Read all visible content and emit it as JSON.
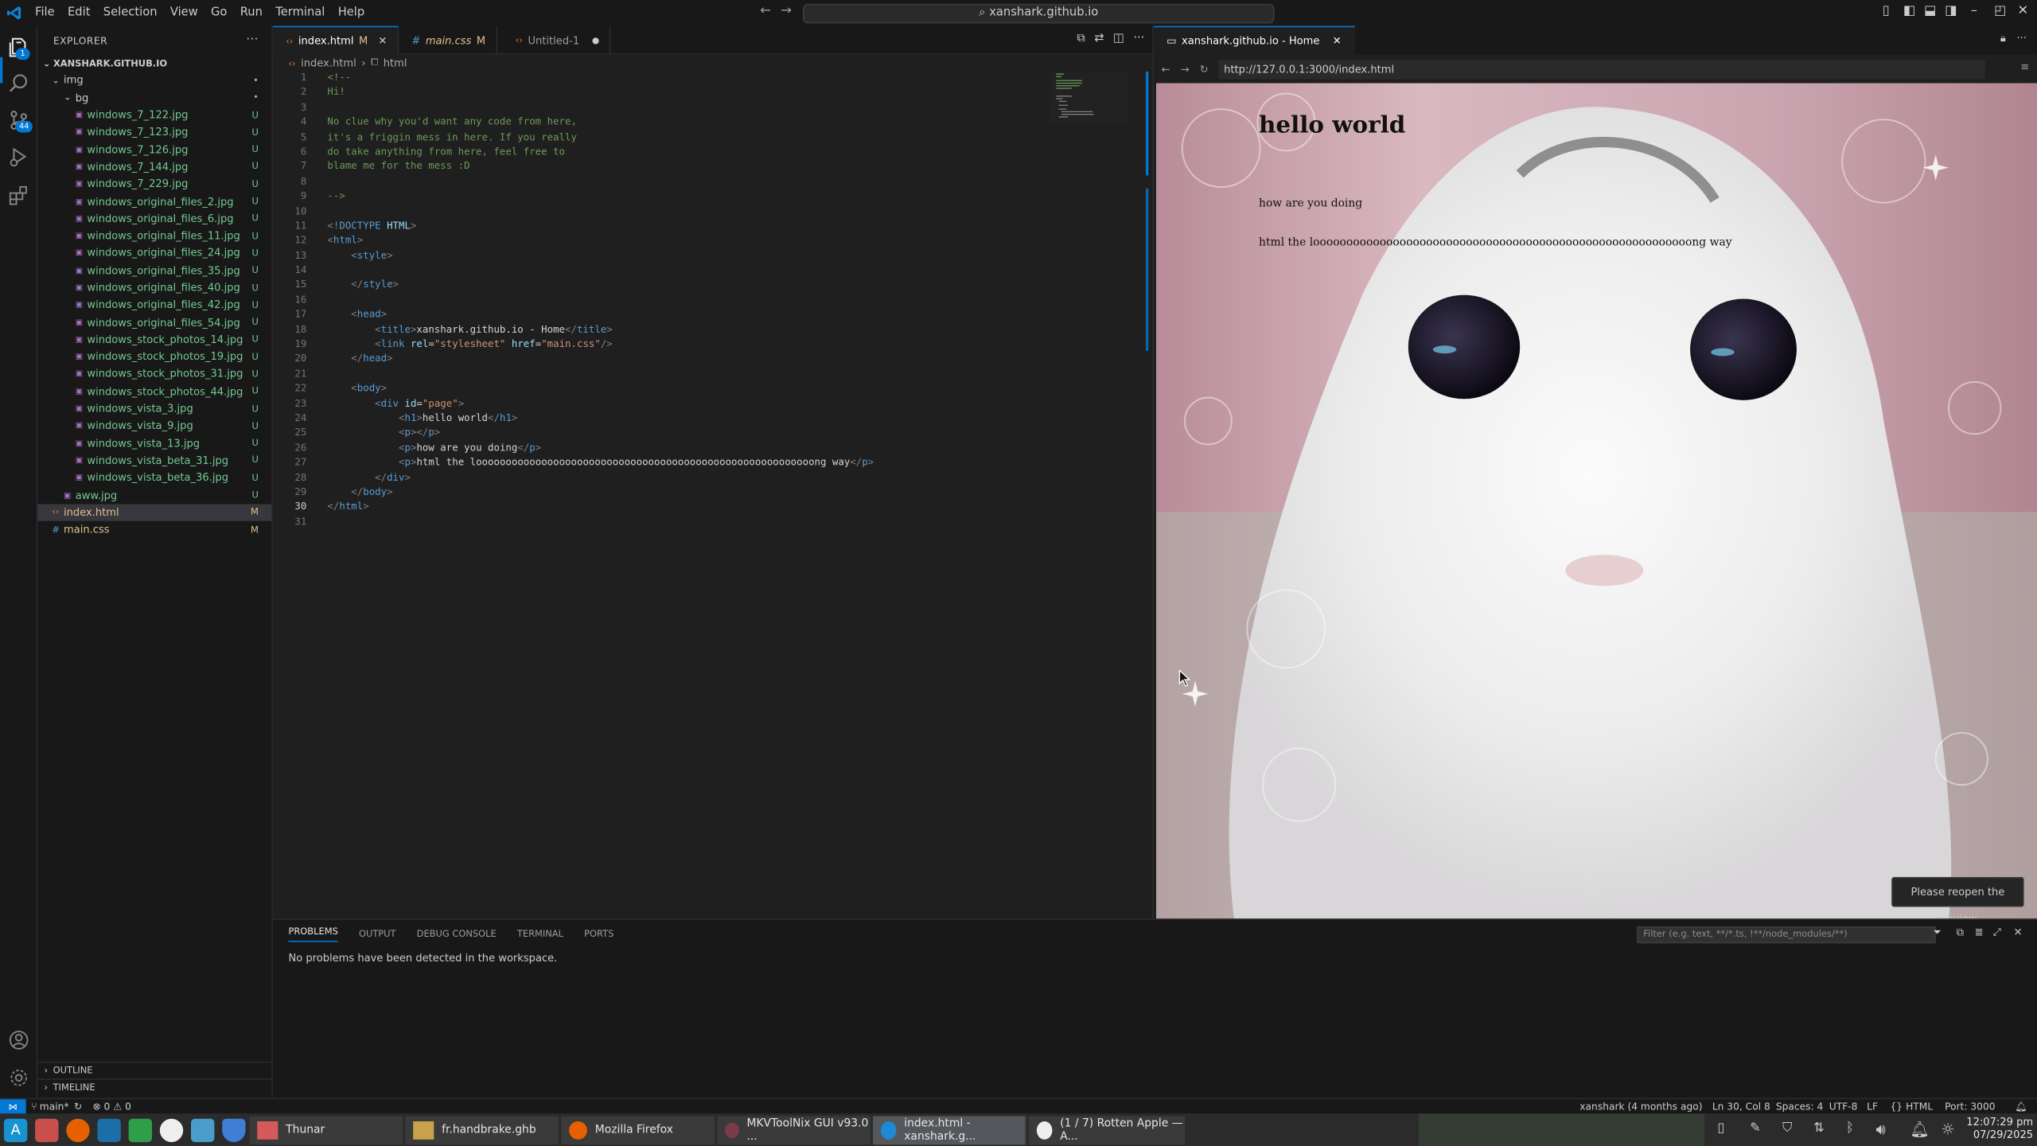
{
  "menu": [
    "File",
    "Edit",
    "Selection",
    "View",
    "Go",
    "Run",
    "Terminal",
    "Help"
  ],
  "command_center": "xanshark.github.io",
  "explorer": {
    "title": "EXPLORER",
    "root": "XANSHARK.GITHUB.IO",
    "items": [
      {
        "label": "img",
        "type": "folder",
        "status": "•",
        "depth": 1
      },
      {
        "label": "bg",
        "type": "folder",
        "status": "•",
        "depth": 2
      },
      {
        "label": "windows_7_122.jpg",
        "status": "U",
        "depth": 3
      },
      {
        "label": "windows_7_123.jpg",
        "status": "U",
        "depth": 3
      },
      {
        "label": "windows_7_126.jpg",
        "status": "U",
        "depth": 3
      },
      {
        "label": "windows_7_144.jpg",
        "status": "U",
        "depth": 3
      },
      {
        "label": "windows_7_229.jpg",
        "status": "U",
        "depth": 3
      },
      {
        "label": "windows_original_files_2.jpg",
        "status": "U",
        "depth": 3
      },
      {
        "label": "windows_original_files_6.jpg",
        "status": "U",
        "depth": 3
      },
      {
        "label": "windows_original_files_11.jpg",
        "status": "U",
        "depth": 3
      },
      {
        "label": "windows_original_files_24.jpg",
        "status": "U",
        "depth": 3
      },
      {
        "label": "windows_original_files_35.jpg",
        "status": "U",
        "depth": 3
      },
      {
        "label": "windows_original_files_40.jpg",
        "status": "U",
        "depth": 3
      },
      {
        "label": "windows_original_files_42.jpg",
        "status": "U",
        "depth": 3
      },
      {
        "label": "windows_original_files_54.jpg",
        "status": "U",
        "depth": 3
      },
      {
        "label": "windows_stock_photos_14.jpg",
        "status": "U",
        "depth": 3
      },
      {
        "label": "windows_stock_photos_19.jpg",
        "status": "U",
        "depth": 3
      },
      {
        "label": "windows_stock_photos_31.jpg",
        "status": "U",
        "depth": 3
      },
      {
        "label": "windows_stock_photos_44.jpg",
        "status": "U",
        "depth": 3
      },
      {
        "label": "windows_vista_3.jpg",
        "status": "U",
        "depth": 3
      },
      {
        "label": "windows_vista_9.jpg",
        "status": "U",
        "depth": 3
      },
      {
        "label": "windows_vista_13.jpg",
        "status": "U",
        "depth": 3
      },
      {
        "label": "windows_vista_beta_31.jpg",
        "status": "U",
        "depth": 3
      },
      {
        "label": "windows_vista_beta_36.jpg",
        "status": "U",
        "depth": 3
      },
      {
        "label": "aww.jpg",
        "status": "U",
        "depth": 2
      },
      {
        "label": "index.html",
        "status": "M",
        "depth": 1,
        "selected": true
      },
      {
        "label": "main.css",
        "status": "M",
        "depth": 1
      }
    ],
    "outline": "OUTLINE",
    "timeline": "TIMELINE"
  },
  "tabs": [
    {
      "label": "index.html",
      "mod": "M",
      "active": true
    },
    {
      "label": "main.css",
      "mod": "M"
    },
    {
      "label": "Untitled-1",
      "dirty": true
    }
  ],
  "breadcrumb": [
    "index.html",
    "html"
  ],
  "code": [
    [
      [
        "cm",
        "<!--"
      ]
    ],
    [
      [
        "cm",
        "Hi!"
      ]
    ],
    [],
    [
      [
        "cm",
        "No clue why you'd want any code from here,"
      ]
    ],
    [
      [
        "cm",
        "it's a friggin mess in here. If you really"
      ]
    ],
    [
      [
        "cm",
        "do take anything from here, feel free to"
      ]
    ],
    [
      [
        "cm",
        "blame me for the mess :D"
      ]
    ],
    [],
    [
      [
        "cm",
        "-->"
      ]
    ],
    [],
    [
      [
        "tg",
        "<!"
      ],
      [
        "tn",
        "DOCTYPE "
      ],
      [
        "at",
        "HTML"
      ],
      [
        "tg",
        ">"
      ]
    ],
    [
      [
        "tg",
        "<"
      ],
      [
        "tn",
        "html"
      ],
      [
        "tg",
        ">"
      ]
    ],
    [
      [
        "tx",
        "    "
      ],
      [
        "tg",
        "<"
      ],
      [
        "tn",
        "style"
      ],
      [
        "tg",
        ">"
      ]
    ],
    [],
    [
      [
        "tx",
        "    "
      ],
      [
        "tg",
        "</"
      ],
      [
        "tn",
        "style"
      ],
      [
        "tg",
        ">"
      ]
    ],
    [],
    [
      [
        "tx",
        "    "
      ],
      [
        "tg",
        "<"
      ],
      [
        "tn",
        "head"
      ],
      [
        "tg",
        ">"
      ]
    ],
    [
      [
        "tx",
        "        "
      ],
      [
        "tg",
        "<"
      ],
      [
        "tn",
        "title"
      ],
      [
        "tg",
        ">"
      ],
      [
        "tx",
        "xanshark.github.io - Home"
      ],
      [
        "tg",
        "</"
      ],
      [
        "tn",
        "title"
      ],
      [
        "tg",
        ">"
      ]
    ],
    [
      [
        "tx",
        "        "
      ],
      [
        "tg",
        "<"
      ],
      [
        "tn",
        "link "
      ],
      [
        "at",
        "rel"
      ],
      [
        "tx",
        "="
      ],
      [
        "sv",
        "\"stylesheet\" "
      ],
      [
        "at",
        "href"
      ],
      [
        "tx",
        "="
      ],
      [
        "sv",
        "\"main.css\""
      ],
      [
        "tg",
        "/>"
      ]
    ],
    [
      [
        "tx",
        "    "
      ],
      [
        "tg",
        "</"
      ],
      [
        "tn",
        "head"
      ],
      [
        "tg",
        ">"
      ]
    ],
    [],
    [
      [
        "tx",
        "    "
      ],
      [
        "tg",
        "<"
      ],
      [
        "tn",
        "body"
      ],
      [
        "tg",
        ">"
      ]
    ],
    [
      [
        "tx",
        "        "
      ],
      [
        "tg",
        "<"
      ],
      [
        "tn",
        "div "
      ],
      [
        "at",
        "id"
      ],
      [
        "tx",
        "="
      ],
      [
        "sv",
        "\"page\""
      ],
      [
        "tg",
        ">"
      ]
    ],
    [
      [
        "tx",
        "            "
      ],
      [
        "tg",
        "<"
      ],
      [
        "tn",
        "h1"
      ],
      [
        "tg",
        ">"
      ],
      [
        "tx",
        "hello world"
      ],
      [
        "tg",
        "</"
      ],
      [
        "tn",
        "h1"
      ],
      [
        "tg",
        ">"
      ]
    ],
    [
      [
        "tx",
        "            "
      ],
      [
        "tg",
        "<"
      ],
      [
        "tn",
        "p"
      ],
      [
        "tg",
        "></"
      ],
      [
        "tn",
        "p"
      ],
      [
        "tg",
        ">"
      ]
    ],
    [
      [
        "tx",
        "            "
      ],
      [
        "tg",
        "<"
      ],
      [
        "tn",
        "p"
      ],
      [
        "tg",
        ">"
      ],
      [
        "tx",
        "how are you doing"
      ],
      [
        "tg",
        "</"
      ],
      [
        "tn",
        "p"
      ],
      [
        "tg",
        ">"
      ]
    ],
    [
      [
        "tx",
        "            "
      ],
      [
        "tg",
        "<"
      ],
      [
        "tn",
        "p"
      ],
      [
        "tg",
        ">"
      ],
      [
        "tx",
        "html the looooooooooooooooooooooooooooooooooooooooooooooooooooooooong way"
      ],
      [
        "tg",
        "</"
      ],
      [
        "tn",
        "p"
      ],
      [
        "tg",
        ">"
      ]
    ],
    [
      [
        "tx",
        "        "
      ],
      [
        "tg",
        "</"
      ],
      [
        "tn",
        "div"
      ],
      [
        "tg",
        ">"
      ]
    ],
    [
      [
        "tx",
        "    "
      ],
      [
        "tg",
        "</"
      ],
      [
        "tn",
        "body"
      ],
      [
        "tg",
        ">"
      ]
    ],
    [
      [
        "tg",
        "</"
      ],
      [
        "tn",
        "html"
      ],
      [
        "tg",
        ">"
      ]
    ],
    []
  ],
  "preview": {
    "tab_title": "xanshark.github.io - Home",
    "url": "http://127.0.0.1:3000/index.html",
    "h1": "hello world",
    "p1": "how are you doing",
    "p2": "html the looooooooooooooooooooooooooooooooooooooooooooooooooooooooong way",
    "reopen": "Please reopen the preview."
  },
  "panel": {
    "tabs": [
      "PROBLEMS",
      "OUTPUT",
      "DEBUG CONSOLE",
      "TERMINAL",
      "PORTS"
    ],
    "filter_placeholder": "Filter (e.g. text, **/*.ts, !**/node_modules/**)",
    "message": "No problems have been detected in the workspace."
  },
  "status": {
    "branch": "main*",
    "problems": "⊗ 0 ⚠ 0",
    "blame": "xanshark (4 months ago)",
    "position": "Ln 30, Col 8",
    "spaces": "Spaces: 4",
    "encoding": "UTF-8",
    "eol": "LF",
    "lang": "HTML",
    "port": "Port: 3000"
  },
  "taskbar": {
    "apps": [
      {
        "label": "Thunar",
        "badge": "2"
      },
      {
        "label": "fr.handbrake.ghb",
        "badge": "2"
      },
      {
        "label": "Mozilla Firefox"
      },
      {
        "label": "MKVToolNix GUI v93.0 ..."
      },
      {
        "label": "index.html - xanshark.g...",
        "active": true
      },
      {
        "label": "(1 / 7) Rotten Apple — A..."
      }
    ],
    "time": "12:07:29 pm",
    "date": "07/29/2025"
  },
  "colors": {
    "accent": "#0078d4",
    "untracked": "#73c991",
    "modified": "#e2c08d"
  }
}
